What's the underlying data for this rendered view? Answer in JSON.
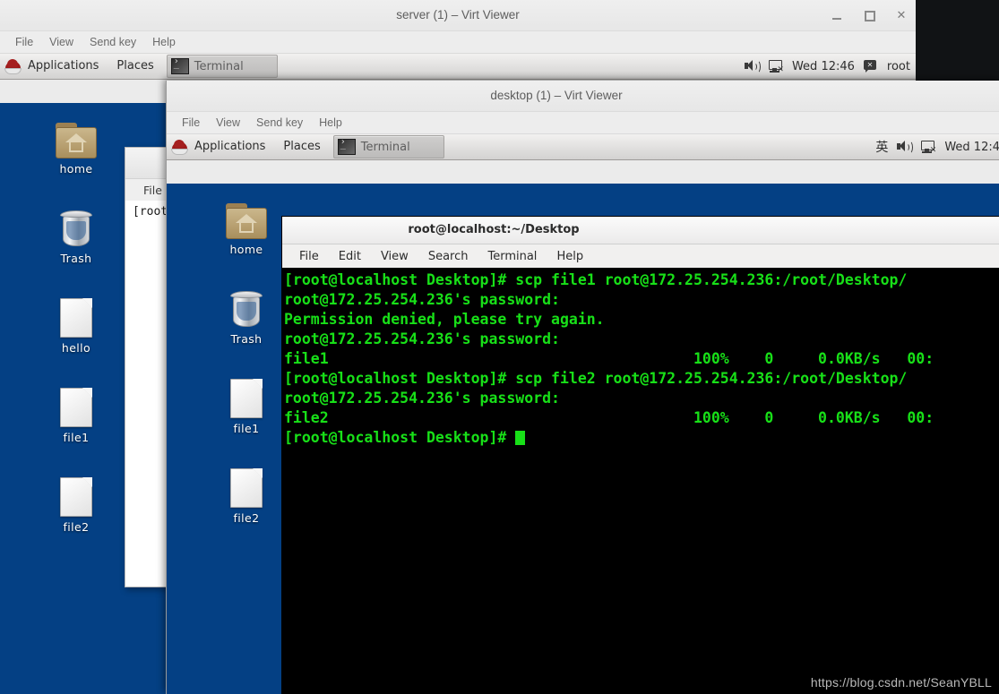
{
  "outer_window": {
    "title": "server (1) – Virt Viewer",
    "window_buttons": [
      {
        "name": "minimize",
        "glyph": "_"
      },
      {
        "name": "maximize",
        "glyph": "□"
      },
      {
        "name": "close",
        "glyph": "✕"
      }
    ],
    "menus": [
      "File",
      "View",
      "Send key",
      "Help"
    ],
    "panel": {
      "applications": "Applications",
      "places": "Places",
      "task_button": "Terminal",
      "clock": "Wed 12:46",
      "user": "root",
      "tray_icons": [
        "speaker-icon",
        "network-disconnected-icon",
        "user-icon"
      ]
    },
    "desktop_icons": [
      {
        "label": "home",
        "icon": "home-folder-icon"
      },
      {
        "label": "Trash",
        "icon": "trash-icon"
      },
      {
        "label": "hello",
        "icon": "text-file-icon"
      },
      {
        "label": "file1",
        "icon": "text-file-icon"
      },
      {
        "label": "file2",
        "icon": "text-file-icon"
      }
    ],
    "background_terminal": {
      "menu": "File",
      "text": "[root"
    }
  },
  "inner_window": {
    "title": "desktop (1) – Virt Viewer",
    "menus": [
      "File",
      "View",
      "Send key",
      "Help"
    ],
    "panel": {
      "applications": "Applications",
      "places": "Places",
      "task_button": "Terminal",
      "ime": "英",
      "clock": "Wed 12:4",
      "tray_icons": [
        "ime-icon",
        "speaker-icon",
        "network-disconnected-icon"
      ]
    },
    "desktop_icons": [
      {
        "label": "home",
        "icon": "home-folder-icon"
      },
      {
        "label": "Trash",
        "icon": "trash-icon"
      },
      {
        "label": "file1",
        "icon": "text-file-icon"
      },
      {
        "label": "file2",
        "icon": "text-file-icon"
      }
    ]
  },
  "terminal": {
    "title": "root@localhost:~/Desktop",
    "menus": [
      "File",
      "Edit",
      "View",
      "Search",
      "Terminal",
      "Help"
    ],
    "colors": {
      "background": "#000000",
      "foreground": "#18e018"
    },
    "lines": [
      "[root@localhost Desktop]# scp file1 root@172.25.254.236:/root/Desktop/",
      "root@172.25.254.236's password:",
      "Permission denied, please try again.",
      "root@172.25.254.236's password:",
      "file1                                         100%    0     0.0KB/s   00:",
      "[root@localhost Desktop]# scp file2 root@172.25.254.236:/root/Desktop/",
      "root@172.25.254.236's password:",
      "file2                                         100%    0     0.0KB/s   00:",
      "[root@localhost Desktop]# "
    ]
  },
  "watermark": "https://blog.csdn.net/SeanYBLL"
}
